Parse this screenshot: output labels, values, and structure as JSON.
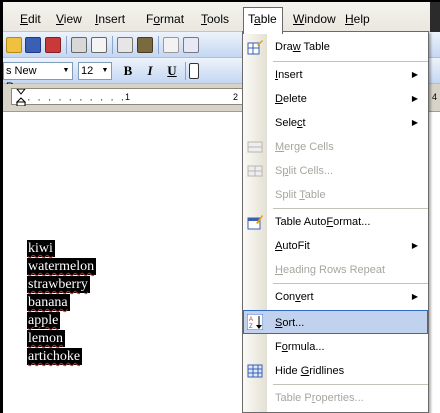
{
  "menubar": {
    "items": [
      {
        "label": "Edit",
        "ul": "E",
        "rest": "dit"
      },
      {
        "label": "View",
        "ul": "V",
        "rest": "iew"
      },
      {
        "label": "Insert",
        "ul": "I",
        "rest": "nsert"
      },
      {
        "label": "Format",
        "pre": "F",
        "ul": "o",
        "rest": "rmat"
      },
      {
        "label": "Tools",
        "ul": "T",
        "rest": "ools"
      },
      {
        "label": "Table",
        "pre": "T",
        "ul": "a",
        "rest": "ble"
      },
      {
        "label": "Window",
        "ul": "W",
        "rest": "indow"
      },
      {
        "label": "Help",
        "ul": "H",
        "rest": "elp"
      }
    ],
    "active": "Table"
  },
  "formatting": {
    "font_name": "s New Roman",
    "font_size": "12",
    "bold": "B",
    "italic": "I",
    "underline": "U"
  },
  "ruler": {
    "numbers": [
      "1",
      "2",
      "4"
    ]
  },
  "document": {
    "words": [
      "kiwi",
      "watermelon",
      "strawberry",
      "banana",
      "apple",
      "lemon",
      "artichoke"
    ]
  },
  "table_menu": {
    "items": {
      "draw_table": {
        "pre": "Dra",
        "ul": "w",
        "rest": " Table"
      },
      "insert": {
        "pre": "",
        "ul": "I",
        "rest": "nsert"
      },
      "delete": {
        "pre": "",
        "ul": "D",
        "rest": "elete"
      },
      "select": {
        "pre": "Sele",
        "ul": "c",
        "rest": "t"
      },
      "merge_cells": {
        "pre": "",
        "ul": "M",
        "rest": "erge Cells"
      },
      "split_cells": {
        "pre": "S",
        "ul": "p",
        "rest": "lit Cells..."
      },
      "split_table": {
        "pre": "Split ",
        "ul": "T",
        "rest": "able"
      },
      "autoformat": {
        "pre": "Table Auto",
        "ul": "F",
        "rest": "ormat..."
      },
      "autofit": {
        "pre": "",
        "ul": "A",
        "rest": "utoFit"
      },
      "heading_rows": {
        "pre": "",
        "ul": "H",
        "rest": "eading Rows Repeat"
      },
      "convert": {
        "pre": "Con",
        "ul": "v",
        "rest": "ert"
      },
      "sort": {
        "pre": "",
        "ul": "S",
        "rest": "ort..."
      },
      "formula": {
        "pre": "F",
        "ul": "o",
        "rest": "rmula..."
      },
      "hide_gridlines": {
        "pre": "Hide ",
        "ul": "G",
        "rest": "ridlines"
      },
      "table_properties": {
        "pre": "Table P",
        "ul": "r",
        "rest": "operties..."
      }
    },
    "highlighted": "Sort..."
  },
  "colors": {
    "menu_highlight": "#c1d2ee",
    "menu_highlight_border": "#316ac5",
    "disabled_text": "#a7a69e",
    "toolbar_top": "#eef3fb",
    "toolbar_bottom": "#c4d7f2"
  }
}
